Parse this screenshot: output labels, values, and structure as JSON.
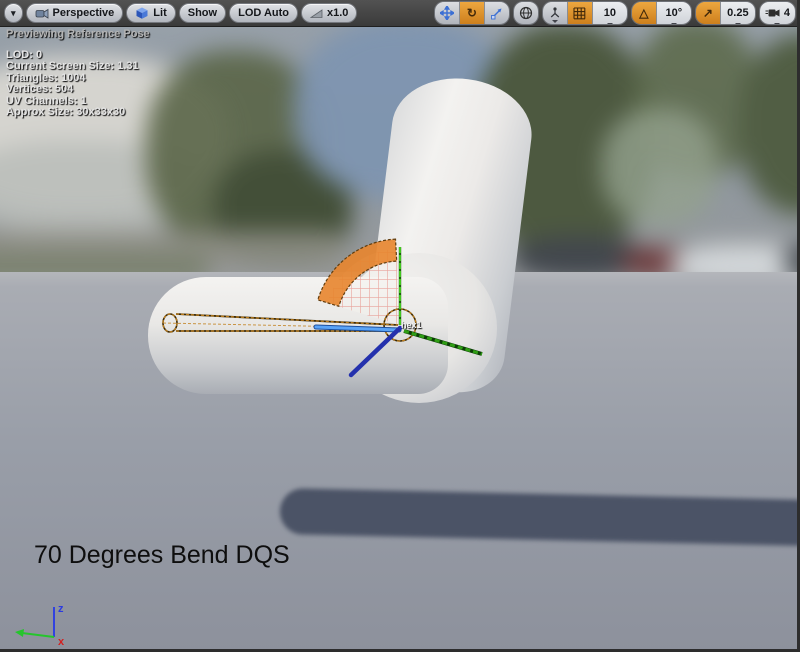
{
  "toolbar": {
    "left": {
      "perspective": "Perspective",
      "lit": "Lit",
      "show": "Show",
      "lod_auto": "LOD Auto",
      "screen_size": "x1.0"
    },
    "right": {
      "grid_snap_value": "10",
      "angle_snap_value": "10°",
      "scale_snap_value": "0.25",
      "camera_speed_value": "4"
    }
  },
  "icons": {
    "caret_down": "▾",
    "rotate": "↻",
    "triangle": "△",
    "arrow_ne": "↗"
  },
  "stats": {
    "preview": "Previewing Reference Pose",
    "lines": [
      "LOD: 0",
      "Current Screen Size: 1.31",
      "Triangles: 1004",
      "Vertices: 504",
      "UV Channels: 1",
      "Approx Size: 30x33x30"
    ]
  },
  "scene": {
    "bone_label": "hex1",
    "caption": "70 Degrees Bend DQS"
  },
  "axis_widget": {
    "z": "z",
    "x": "x"
  },
  "colors": {
    "accent_orange": "#d98e2b",
    "bone_orange": "#c2801c",
    "gizmo_blue": "#4d9bf5",
    "gizmo_navy": "#2431ad",
    "gizmo_green": "#2f9e14",
    "shadow_blue_gray": "#4b5366"
  }
}
